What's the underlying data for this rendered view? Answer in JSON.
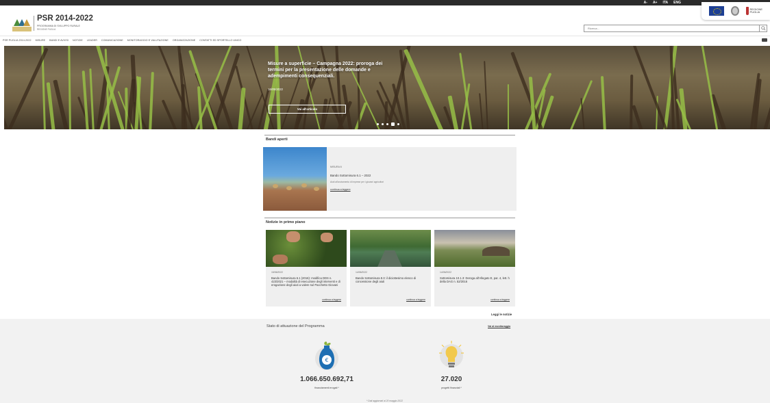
{
  "utility_bar": {
    "font_smaller": "A-",
    "font_larger": "A+",
    "language_1": "ITA",
    "language_2": "ENG"
  },
  "header": {
    "title": "PSR 2014-2022",
    "subtitle": "Programma di sviluppo rurale",
    "subtitle2": "Regione Puglia",
    "search_placeholder": "Ricerca..."
  },
  "nav": {
    "items": [
      "PSR Puglia 2014-2022",
      "Misure",
      "Bandi e avvisi",
      "Notizie",
      "Leader",
      "Comunicazione",
      "Monitoraggio e valutazione",
      "Organizzazione",
      "Contatti ed Sportello Unico"
    ]
  },
  "hero": {
    "title": "Misure a superficie – Campagna 2022: proroga dei termini per la presentazione delle domande e adempimenti consequenziali.",
    "date": "16/05/2022",
    "button": "Vai all'articolo",
    "slide_count": 5,
    "active_slide": 4
  },
  "bandi": {
    "section_title": "Bandi aperti",
    "card": {
      "meta": "Misura 6",
      "name": "Bando Sottomisura 6.1 – 2022",
      "description": "Aiuti all'avviamento di imprese per i giovani agricoltori",
      "link": "continua a leggere"
    }
  },
  "news": {
    "section_title": "Notizie in primo piano",
    "items": [
      {
        "date": "15/06/2022",
        "text": "Bando Sottomisura 6.1 (2016): modifica DDS n. 423/2021 – modalità di esecuzione degli interventi e di erogazione degli aiuti a valere sul Pacchetto Giovani",
        "link": "continua a leggere"
      },
      {
        "date": "14/06/2022",
        "text": "Bando Sottomisura 8.3: il diciottesimo elenco di concessione degli aiuti",
        "link": "continua a leggere"
      },
      {
        "date": "14/06/2022",
        "text": "Sottomisura 10.1.3: Deroga all'Allegato E, par. 4, lett. h della DAG n. 52/2016",
        "link": "continua a leggere"
      }
    ],
    "all_link": "Leggi le notizie"
  },
  "stats": {
    "title": "Stato di attuazione del Programma",
    "link": "Vai al monitoraggio",
    "funds_value": "1.066.650.692,71",
    "funds_label": "finanziamenti erogati *",
    "projects_value": "27.020",
    "projects_label": "progetti finanziati *",
    "note": "* Dati aggiornati al 20 maggio 2022"
  },
  "colors": {
    "accent_green": "#4a8c3a",
    "money_bag": "#1e6fb3",
    "bulb": "#f2c94c",
    "dark_bar": "#2b2b2b"
  }
}
